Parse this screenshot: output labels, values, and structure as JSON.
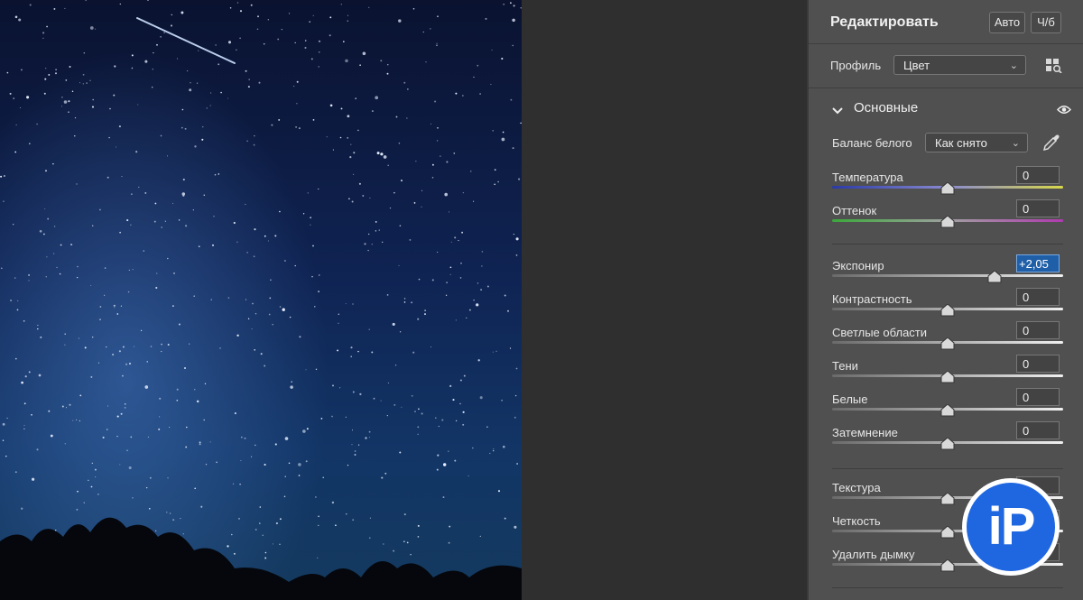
{
  "header": {
    "title": "Редактировать",
    "auto_label": "Авто",
    "bw_label": "Ч/б"
  },
  "profile": {
    "label": "Профиль",
    "value": "Цвет",
    "browse_icon": "grid-search-icon"
  },
  "section": {
    "title": "Основные",
    "toggle_icon": "chevron-down-icon",
    "visibility_icon": "eye-icon"
  },
  "white_balance": {
    "label": "Баланс белого",
    "value": "Как снято",
    "picker_icon": "eyedropper-icon"
  },
  "sliders": [
    {
      "id": "temperature",
      "label": "Температура",
      "value": "0",
      "level": 0.5
    },
    {
      "id": "tint",
      "label": "Оттенок",
      "value": "0",
      "level": 0.5
    },
    {
      "id": "exposure",
      "label": "Экспонир",
      "value": "+2,05",
      "level": 0.705
    },
    {
      "id": "contrast",
      "label": "Контрастность",
      "value": "0",
      "level": 0.5
    },
    {
      "id": "highlights",
      "label": "Светлые области",
      "value": "0",
      "level": 0.5
    },
    {
      "id": "shadows",
      "label": "Тени",
      "value": "0",
      "level": 0.5
    },
    {
      "id": "whites",
      "label": "Белые",
      "value": "0",
      "level": 0.5
    },
    {
      "id": "blacks",
      "label": "Затемнение",
      "value": "0",
      "level": 0.5
    },
    {
      "id": "texture",
      "label": "Текстура",
      "value": "",
      "level": 0.5
    },
    {
      "id": "clarity",
      "label": "Четкость",
      "value": "",
      "level": 0.5
    },
    {
      "id": "dehaze",
      "label": "Удалить дымку",
      "value": "",
      "level": 0.5
    }
  ],
  "watermark": {
    "text": "iP"
  },
  "colors": {
    "panel": "#505050",
    "canvas": "#2f2f2f",
    "accent": "#1f5fa8",
    "badge": "#1f67e0"
  }
}
